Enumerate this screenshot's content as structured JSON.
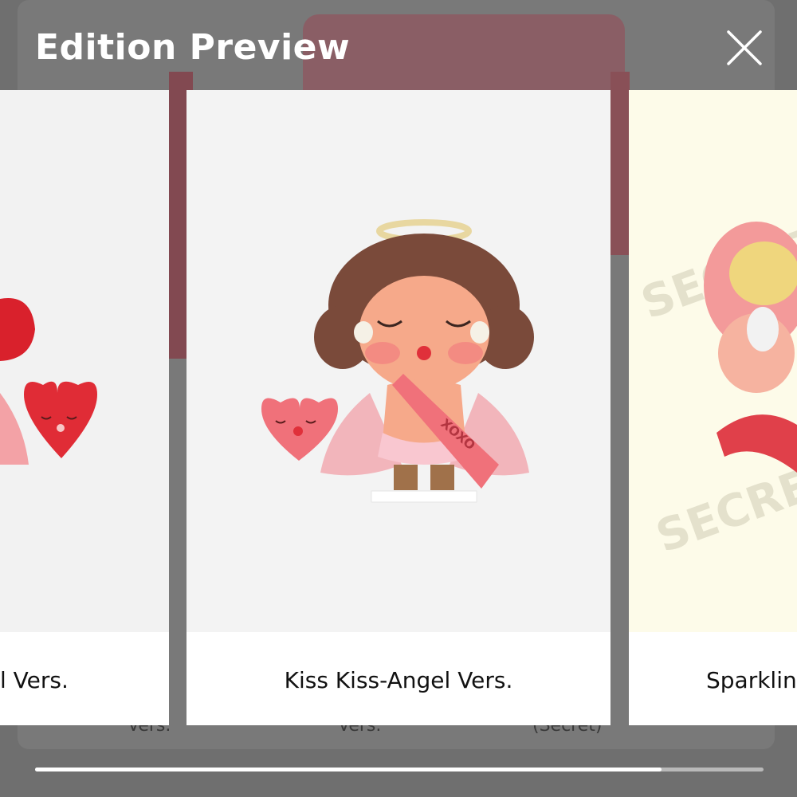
{
  "header": {
    "title": "Edition Preview"
  },
  "icons": {
    "close": "close-icon"
  },
  "background_captions": [
    "Vers.",
    "Vers.",
    "(Secret)"
  ],
  "cards": [
    {
      "label": "l Vers.",
      "image": "heart-cupid-figure-image"
    },
    {
      "label": "Kiss Kiss-Angel Vers.",
      "image": "angel-figure-image"
    },
    {
      "label": "Sparklin",
      "image": "secret-figure-image",
      "watermark": "SECRET"
    }
  ],
  "scroll": {
    "progress": 0.86
  },
  "colors": {
    "title": "#ffffff",
    "accent_pink": "#f0717a",
    "heart_red": "#e02c36"
  }
}
